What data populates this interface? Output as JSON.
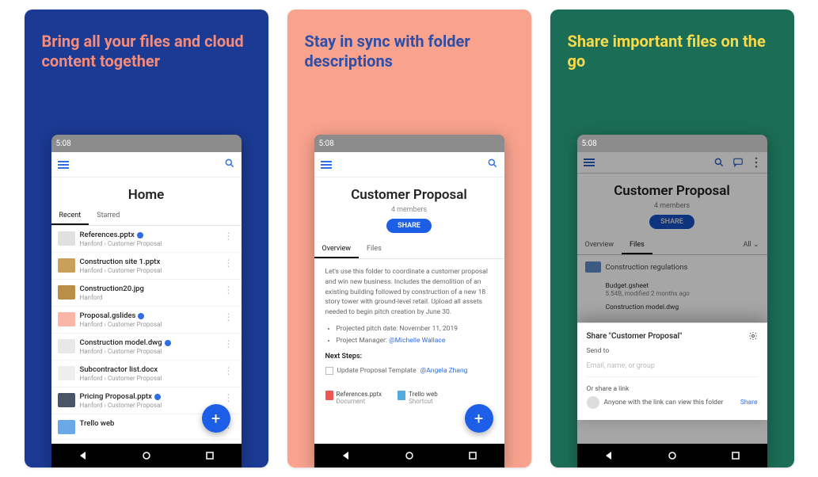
{
  "cards": [
    {
      "headline": "Bring all your files and cloud content together"
    },
    {
      "headline": "Stay in sync with folder descriptions"
    },
    {
      "headline": "Share important files on the go"
    }
  ],
  "phone": {
    "time": "5:08"
  },
  "card1": {
    "title": "Home",
    "tabs": {
      "recent": "Recent",
      "starred": "Starred"
    },
    "files": [
      {
        "name": "References.pptx",
        "sub": "Hanford › Customer Proposal",
        "sync": true,
        "thumb": "#e0e0e0"
      },
      {
        "name": "Construction site 1.pptx",
        "sub": "Hanford › Customer Proposal",
        "sync": false,
        "thumb": "#c8a05a"
      },
      {
        "name": "Construction20.jpg",
        "sub": "Hanford",
        "sync": false,
        "thumb": "#b98e46"
      },
      {
        "name": "Proposal.gslides",
        "sub": "Hanford › Customer Proposal",
        "sync": true,
        "thumb": "#f9b5a5"
      },
      {
        "name": "Construction model.dwg",
        "sub": "Hanford › Customer Proposal",
        "sync": true,
        "thumb": "#e8e8e8"
      },
      {
        "name": "Subcontractor list.docx",
        "sub": "Hanford › Customer Proposal",
        "sync": false,
        "thumb": "#eeeeee"
      },
      {
        "name": "Pricing Proposal.pptx",
        "sub": "Hanford › Customer Proposal",
        "sync": true,
        "thumb": "#4a5568"
      },
      {
        "name": "Trello web",
        "sub": "",
        "sync": false,
        "thumb": "#6aa8e8"
      }
    ]
  },
  "card2": {
    "title": "Customer Proposal",
    "members": "4 members",
    "share": "SHARE",
    "tabs": {
      "overview": "Overview",
      "files": "Files"
    },
    "desc": "Let's use this folder to coordinate a customer proposal and win new business. Includes the demolition of an existing building followed by construction of a new 18 story tower with ground-level retail. Upload all assets needed to begin pitch creation by June 30.",
    "bullets": {
      "pitch_label": "Projected pitch date:",
      "pitch_date": "November 11, 2019",
      "pm_label": "Project Manager:",
      "pm_name": "@Michelle Wallace"
    },
    "next_steps": "Next Steps:",
    "task": {
      "label": "Update Proposal Template",
      "assignee": "@Angela Zhang"
    },
    "mini_files": [
      {
        "name": "References.pptx",
        "type": "Document",
        "color": "#e55"
      },
      {
        "name": "Trello web",
        "type": "Shortcut",
        "color": "#5ad"
      }
    ]
  },
  "card3": {
    "title": "Customer Proposal",
    "members": "4 members",
    "share": "SHARE",
    "tabs": {
      "overview": "Overview",
      "files": "Files",
      "sort": "All ⌄"
    },
    "folder": "Construction regulations",
    "file_rows": [
      {
        "name": "Budget.gsheet",
        "sub": "5.54B, modified 2 months ago"
      },
      {
        "name": "Construction model.dwg",
        "sub": ""
      }
    ],
    "sheet": {
      "title": "Share \"Customer Proposal\"",
      "send_to": "Send to",
      "placeholder": "Email, name, or group",
      "or": "Or share a link",
      "anyone": "Anyone with the link can view this folder",
      "share": "Share"
    }
  }
}
